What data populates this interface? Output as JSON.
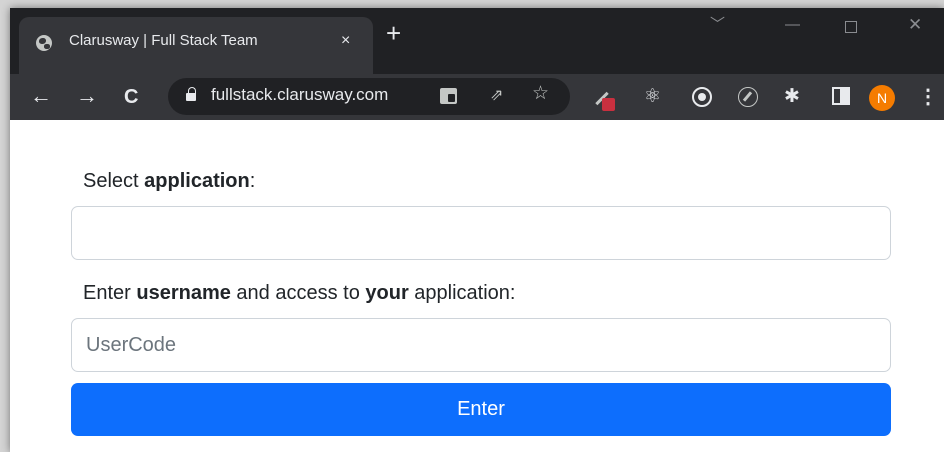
{
  "browser": {
    "tab_title": "Clarusway | Full Stack Team",
    "tab_close": "×",
    "new_tab": "+",
    "url": "fullstack.clarusway.com",
    "profile_initial": "N",
    "window_controls": {
      "chevron": "﹀",
      "minimize": "—",
      "close": "✕"
    },
    "nav": {
      "back": "←",
      "forward": "→",
      "reload": "C"
    },
    "omnibox_icons": {
      "share": "⇗",
      "star": "☆"
    },
    "extensions": {
      "react": "⚛",
      "puzzle": "✱",
      "menu": "⋮"
    }
  },
  "form": {
    "app_label": {
      "prefix": "Select ",
      "bold": "application",
      "suffix": ":"
    },
    "app_value": "",
    "user_label": {
      "part1": "Enter ",
      "bold1": "username",
      "part2": " and access to ",
      "bold2": "your",
      "part3": " application:"
    },
    "user_placeholder": "UserCode",
    "user_value": "",
    "enter_button": "Enter"
  },
  "colors": {
    "primary_button": "#0d6efd",
    "tab_strip": "#202124",
    "toolbar": "#35363a",
    "avatar": "#f57c00"
  }
}
